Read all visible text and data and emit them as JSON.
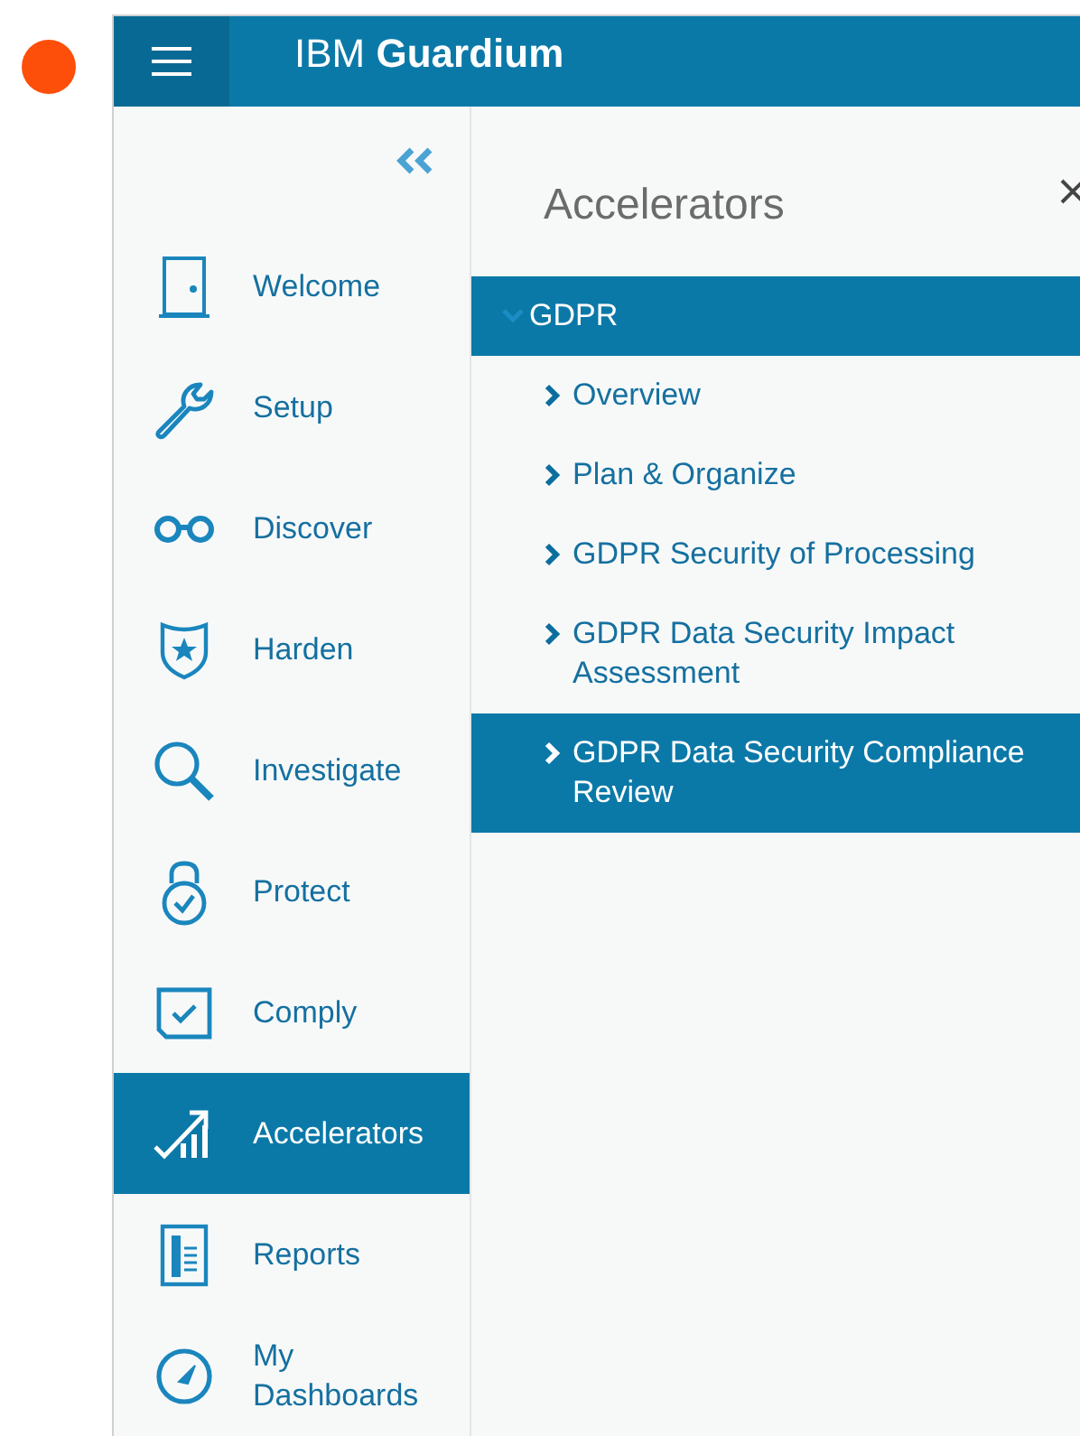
{
  "header": {
    "brand_light": "IBM",
    "brand_bold": "Guardium"
  },
  "sidebar": {
    "items": [
      {
        "label": "Welcome",
        "selected": false
      },
      {
        "label": "Setup",
        "selected": false
      },
      {
        "label": "Discover",
        "selected": false
      },
      {
        "label": "Harden",
        "selected": false
      },
      {
        "label": "Investigate",
        "selected": false
      },
      {
        "label": "Protect",
        "selected": false
      },
      {
        "label": "Comply",
        "selected": false
      },
      {
        "label": "Accelerators",
        "selected": true
      },
      {
        "label": "Reports",
        "selected": false
      },
      {
        "label": "My Dashboards",
        "selected": false
      }
    ]
  },
  "panel": {
    "title": "Accelerators",
    "groups": [
      {
        "label": "GDPR",
        "expanded": true,
        "children": [
          {
            "label": "Overview",
            "selected": false
          },
          {
            "label": "Plan & Organize",
            "selected": false
          },
          {
            "label": "GDPR Security of Processing",
            "selected": false
          },
          {
            "label": "GDPR Data Security Impact Assessment",
            "selected": false
          },
          {
            "label": "GDPR Data Security Compliance Review",
            "selected": true
          }
        ]
      }
    ]
  }
}
